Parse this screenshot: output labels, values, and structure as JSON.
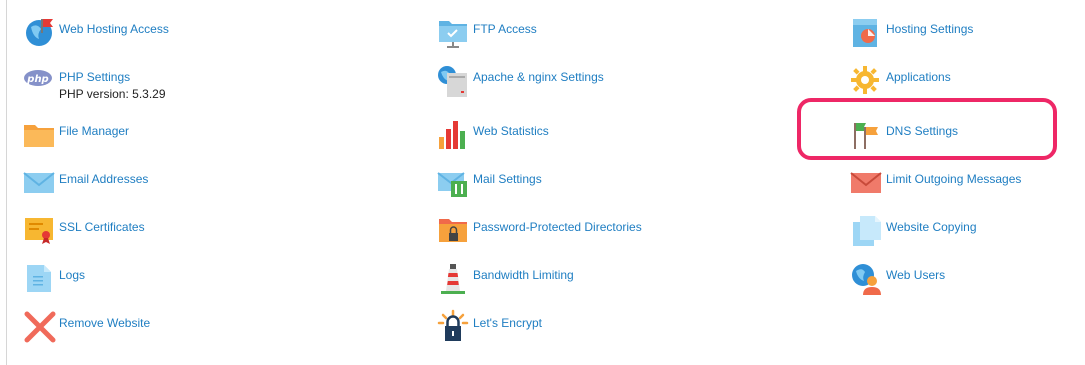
{
  "tools": {
    "web_hosting_access": "Web Hosting Access",
    "php_settings": "PHP Settings",
    "php_version": "PHP version: 5.3.29",
    "file_manager": "File Manager",
    "email_addresses": "Email Addresses",
    "ssl_certificates": "SSL Certificates",
    "logs": "Logs",
    "remove_website": "Remove Website",
    "ftp_access": "FTP Access",
    "apache_nginx": "Apache & nginx Settings",
    "web_statistics": "Web Statistics",
    "mail_settings": "Mail Settings",
    "password_protected": "Password-Protected Directories",
    "bandwidth_limiting": "Bandwidth Limiting",
    "lets_encrypt": "Let's Encrypt",
    "hosting_settings": "Hosting Settings",
    "applications": "Applications",
    "dns_settings": "DNS Settings",
    "limit_outgoing": "Limit Outgoing Messages",
    "website_copying": "Website Copying",
    "web_users": "Web Users"
  },
  "icons": {
    "web_hosting_access": "globe-flag-icon",
    "php_settings": "php-icon",
    "file_manager": "folder-icon",
    "email_addresses": "envelope-icon",
    "ssl_certificates": "certificate-icon",
    "logs": "document-icon",
    "remove_website": "remove-x-icon",
    "ftp_access": "ftp-folder-icon",
    "apache_nginx": "server-globe-icon",
    "web_statistics": "bar-chart-icon",
    "mail_settings": "mail-settings-icon",
    "password_protected": "locked-folder-icon",
    "bandwidth_limiting": "lighthouse-icon",
    "lets_encrypt": "padlock-sun-icon",
    "hosting_settings": "hosting-settings-icon",
    "applications": "gear-icon",
    "dns_settings": "dns-flags-icon",
    "limit_outgoing": "envelope-limit-icon",
    "website_copying": "copy-document-icon",
    "web_users": "globe-user-icon"
  },
  "colors": {
    "link": "#1f7ec2",
    "highlight": "#ee2766"
  }
}
